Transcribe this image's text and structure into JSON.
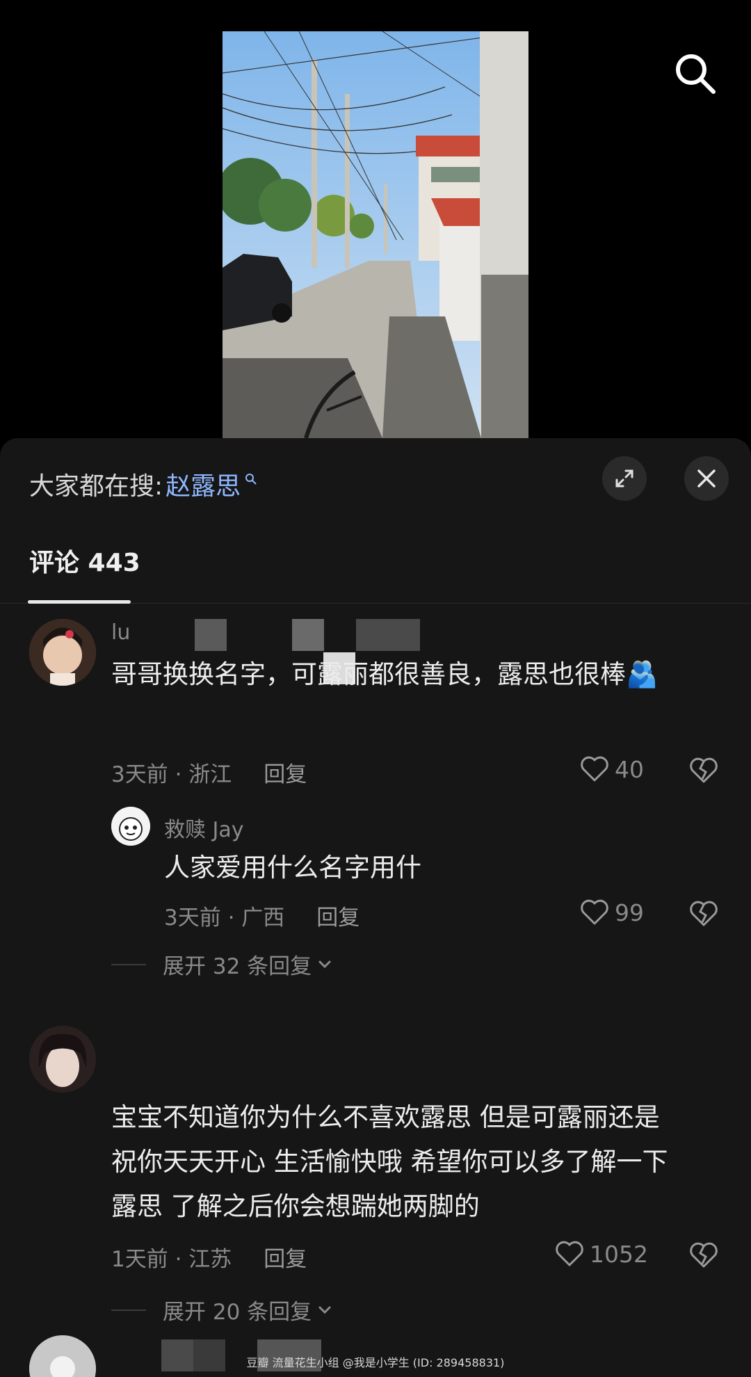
{
  "header": {
    "hot_search_prefix": "大家都在搜:",
    "hot_search_term": "赵露思"
  },
  "tabs": {
    "comments_label": "评论 443"
  },
  "comments": [
    {
      "username": "lu",
      "text": "哥哥换换名字，可露丽都很善良，露思也很棒🫂",
      "time": "3天前 · 浙江",
      "reply_label": "回复",
      "likes": "40",
      "replies": [
        {
          "username": "救赎 Jay",
          "text": "人家爱用什么名字用什",
          "time": "3天前 · 广西",
          "reply_label": "回复",
          "likes": "99"
        }
      ],
      "expand_label": "展开 32 条回复"
    },
    {
      "username": "",
      "text_line1": "宝宝不知道你为什么不喜欢露思 但是可露丽还是",
      "text_line2": "祝你天天开心 生活愉快哦 希望你可以多了解一下",
      "text_line3": "露思 了解之后你会想踹她两脚的",
      "time": "1天前 · 江苏",
      "reply_label": "回复",
      "likes": "1052",
      "expand_label": "展开 20 条回复"
    }
  ],
  "watermark": "豆瓣  流量花生小组 @我是小学生 (ID: 289458831)",
  "colors": {
    "sheet_bg": "#161616",
    "accent_link": "#8fb7ff",
    "muted_text": "#8a8a8a"
  }
}
